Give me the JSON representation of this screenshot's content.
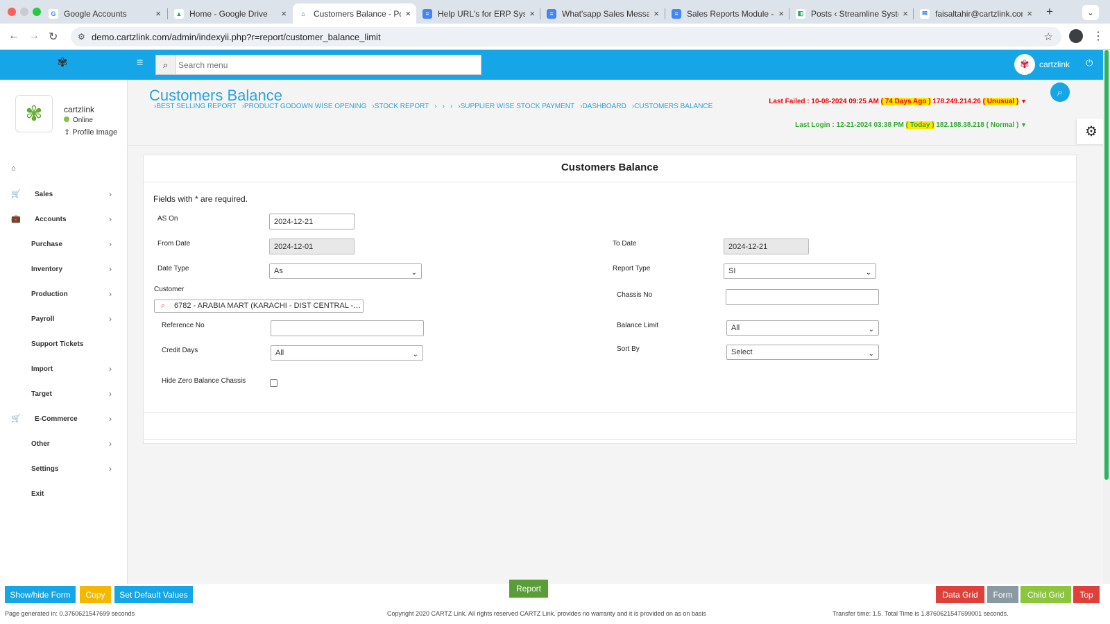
{
  "browser": {
    "tabs": [
      {
        "label": "Google Accounts",
        "fav_color": "#ffffff",
        "fav_text": "G",
        "fav_text_color": "#4285f4"
      },
      {
        "label": "Home - Google Drive",
        "fav_color": "#ffffff",
        "fav_text": "▲",
        "fav_text_color": "#1fa463"
      },
      {
        "label": "Customers Balance - Pow",
        "fav_color": "#ffffff",
        "fav_text": "⌂",
        "fav_text_color": "#2e7d32",
        "active": true
      },
      {
        "label": "Help URL's for ERP Syste",
        "fav_color": "#4285f4",
        "fav_text": "≡",
        "fav_text_color": "#ffffff"
      },
      {
        "label": "What'sapp Sales Messag",
        "fav_color": "#4285f4",
        "fav_text": "≡",
        "fav_text_color": "#ffffff"
      },
      {
        "label": "Sales Reports Module - C",
        "fav_color": "#4285f4",
        "fav_text": "≡",
        "fav_text_color": "#ffffff"
      },
      {
        "label": "Posts ‹ Streamline Syster",
        "fav_color": "#ffffff",
        "fav_text": "◧",
        "fav_text_color": "#2a6"
      },
      {
        "label": "faisaltahir@cartzlink.com",
        "fav_color": "#ffffff",
        "fav_text": "✉",
        "fav_text_color": "#1a73e8"
      }
    ],
    "url": "demo.cartzlink.com/admin/indexyii.php?r=report/customer_balance_limit"
  },
  "header": {
    "search_placeholder": "Search menu",
    "username": "cartzlink"
  },
  "sidebar": {
    "profile_name": "cartzlink",
    "profile_status": "Online",
    "profile_image_label": "Profile Image",
    "items": [
      {
        "label": "",
        "icon": "home-icon",
        "glyph": "⌂",
        "chev": false
      },
      {
        "label": "Sales",
        "icon": "cart-icon",
        "glyph": "🛒",
        "chev": true
      },
      {
        "label": "Accounts",
        "icon": "briefcase-icon",
        "glyph": "💼",
        "chev": true
      },
      {
        "label": "Purchase",
        "icon": "",
        "glyph": "",
        "chev": true
      },
      {
        "label": "Inventory",
        "icon": "",
        "glyph": "",
        "chev": true
      },
      {
        "label": "Production",
        "icon": "",
        "glyph": "",
        "chev": true
      },
      {
        "label": "Payroll",
        "icon": "",
        "glyph": "",
        "chev": true
      },
      {
        "label": "Support Tickets",
        "icon": "",
        "glyph": "",
        "chev": false
      },
      {
        "label": "Import",
        "icon": "",
        "glyph": "",
        "chev": true
      },
      {
        "label": "Target",
        "icon": "",
        "glyph": "",
        "chev": true
      },
      {
        "label": "E-Commerce",
        "icon": "cart-icon",
        "glyph": "🛒",
        "chev": true
      },
      {
        "label": "Other",
        "icon": "",
        "glyph": "",
        "chev": true
      },
      {
        "label": "Settings",
        "icon": "",
        "glyph": "",
        "chev": true
      },
      {
        "label": "Exit",
        "icon": "",
        "glyph": "",
        "chev": false
      }
    ]
  },
  "page": {
    "title": "Customers Balance",
    "breadcrumbs": [
      "›BEST SELLING REPORT",
      "›PRODUCT GODOWN WISE OPENING",
      "›STOCK REPORT",
      "›",
      "›",
      "›",
      "›SUPPLIER WISE STOCK PAYMENT",
      "›DASHBOARD",
      "›CUSTOMERS BALANCE"
    ],
    "last_failed": {
      "prefix": "Last Failed : 10-08-2024 09:25 AM",
      "ago": "( 74 Days Ago )",
      "ip": "178.249.214.26",
      "status": "( Unusual )"
    },
    "last_login": {
      "prefix": "Last Login : 12-21-2024 03:38 PM",
      "ago": "( Today )",
      "ip": "182.188.38.218",
      "status": "( Normal )"
    }
  },
  "form": {
    "heading": "Customers Balance",
    "required_note": "Fields with * are required.",
    "as_on_label": "AS On",
    "as_on_value": "2024-12-21",
    "from_date_label": "From Date",
    "from_date_value": "2024-12-01",
    "to_date_label": "To Date",
    "to_date_value": "2024-12-21",
    "date_type_label": "Date Type",
    "date_type_value": "As",
    "report_type_label": "Report Type",
    "report_type_value": "SI",
    "customer_label": "Customer",
    "customer_value": "6782 - ARABIA MART (KARACHI - DIST CENTRAL -…",
    "chassis_label": "Chassis No",
    "chassis_value": "",
    "reference_label": "Reference No",
    "reference_value": "",
    "balance_limit_label": "Balance Limit",
    "balance_limit_value": "All",
    "credit_days_label": "Credit Days",
    "credit_days_value": "All",
    "sort_by_label": "Sort By",
    "sort_by_value": "Select",
    "hide_zero_label": "Hide Zero Balance Chassis"
  },
  "footer": {
    "show_hide": "Show/hide Form",
    "copy": "Copy",
    "set_default": "Set Default Values",
    "report": "Report",
    "data_grid": "Data Grid",
    "form": "Form",
    "child_grid": "Child Grid",
    "top": "Top",
    "page_generated": "Page generated in: 0.3760621547699 seconds",
    "copyright": "Copyright 2020 CARTZ Link. All rights reserved CARTZ Link. provides no warranty and it is provided on as on basis",
    "transfer": "Transfer time: 1.5. Total Time is 1.8760621547699001 seconds."
  },
  "colors": {
    "brand_blue": "#16a5e6",
    "report_green": "#5a9c35",
    "data_grid_red": "#e0403a",
    "form_grey": "#8a9aa3",
    "child_grid_green": "#8cc63f",
    "copy_yellow": "#f5b800"
  }
}
